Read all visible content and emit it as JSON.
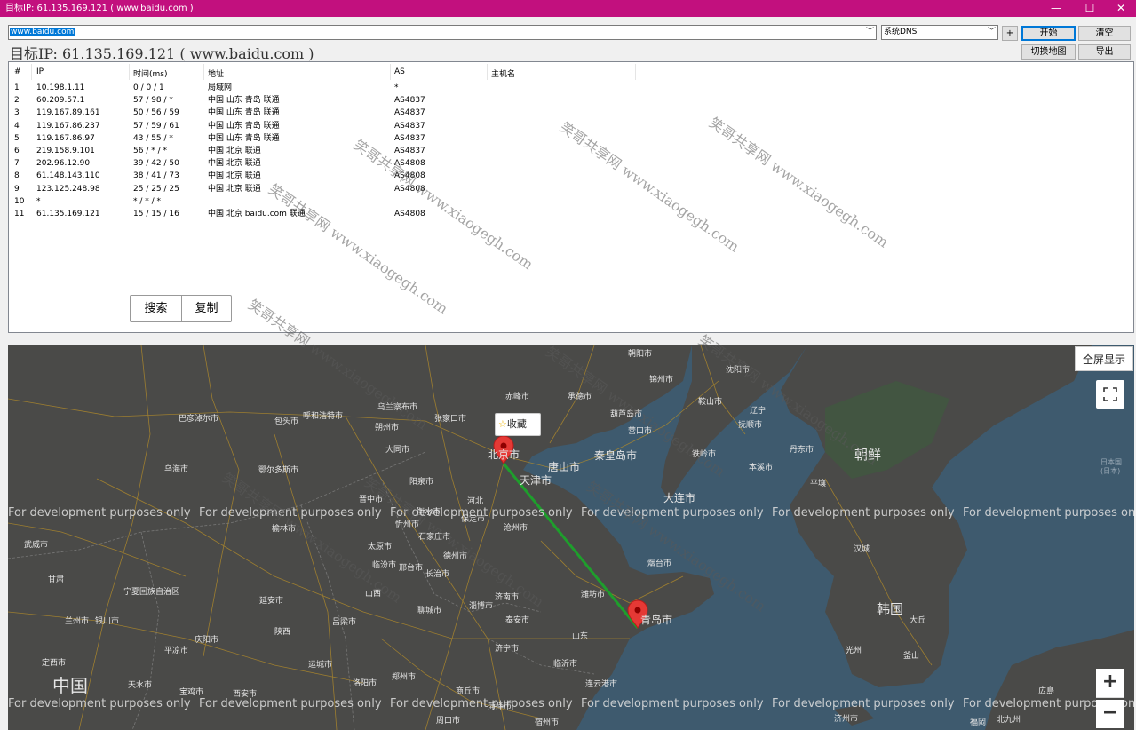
{
  "window": {
    "title": "目标IP: 61.135.169.121 ( www.baidu.com )",
    "minimize": "—",
    "maximize": "☐",
    "close": "✕"
  },
  "toolbar": {
    "url_value": "www.baidu.com",
    "dns_value": "系统DNS",
    "plus_label": "+",
    "start_label": "开始",
    "clear_label": "清空",
    "switch_map_label": "切换地图",
    "export_label": "导出"
  },
  "target_line": "目标IP: 61.135.169.121 ( www.baidu.com )",
  "table": {
    "columns": [
      "#",
      "IP",
      "时间(ms)",
      "地址",
      "AS",
      "主机名"
    ],
    "rows": [
      {
        "num": "1",
        "ip": "10.198.1.11",
        "time": "0 / 0 / 1",
        "addr": "局域网",
        "as": "*",
        "host": ""
      },
      {
        "num": "2",
        "ip": "60.209.57.1",
        "time": "57 / 98 / *",
        "addr": "中国 山东 青岛 联通",
        "as": "AS4837",
        "host": ""
      },
      {
        "num": "3",
        "ip": "119.167.89.161",
        "time": "50 / 56 / 59",
        "addr": "中国 山东 青岛 联通",
        "as": "AS4837",
        "host": ""
      },
      {
        "num": "4",
        "ip": "119.167.86.237",
        "time": "57 / 59 / 61",
        "addr": "中国 山东 青岛 联通",
        "as": "AS4837",
        "host": ""
      },
      {
        "num": "5",
        "ip": "119.167.86.97",
        "time": "43 / 55 / *",
        "addr": "中国 山东 青岛 联通",
        "as": "AS4837",
        "host": ""
      },
      {
        "num": "6",
        "ip": "219.158.9.101",
        "time": "56 / * / *",
        "addr": "中国 北京 联通",
        "as": "AS4837",
        "host": ""
      },
      {
        "num": "7",
        "ip": "202.96.12.90",
        "time": "39 / 42 / 50",
        "addr": "中国 北京 联通",
        "as": "AS4808",
        "host": ""
      },
      {
        "num": "8",
        "ip": "61.148.143.110",
        "time": "38 / 41 / 73",
        "addr": "中国 北京 联通",
        "as": "AS4808",
        "host": ""
      },
      {
        "num": "9",
        "ip": "123.125.248.98",
        "time": "25 / 25 / 25",
        "addr": "中国 北京 联通",
        "as": "AS4808",
        "host": ""
      },
      {
        "num": "10",
        "ip": "*",
        "time": "* / * / *",
        "addr": "",
        "as": "",
        "host": ""
      },
      {
        "num": "11",
        "ip": "61.135.169.121",
        "time": "15 / 15 / 16",
        "addr": "中国 北京 baidu.com 联通",
        "as": "AS4808",
        "host": ""
      }
    ]
  },
  "actions": {
    "search_label": "搜索",
    "copy_label": "复制"
  },
  "map": {
    "fullscreen_label": "全屏显示",
    "favorite_label": "收藏",
    "zoom_in": "+",
    "zoom_out": "−",
    "dev_notice": "For development purposes only",
    "country_china": "中国",
    "korea": "韩国",
    "north_korea": "朝鲜",
    "japan": "日本国\n(日本)",
    "city_labels": [
      "北京市",
      "天津市",
      "唐山市",
      "秦皇岛市",
      "大连市",
      "青岛市",
      "沈阳市",
      "锦州市",
      "营口市",
      "鞍山市",
      "辽宁",
      "石家庄市",
      "保定市",
      "沧州市",
      "邢台市",
      "济南市",
      "淄博市",
      "潍坊市",
      "烟台市",
      "济宁市",
      "临沂市",
      "连云港市",
      "郑州市",
      "太原市",
      "呼和浩特市",
      "包头市",
      "大同市",
      "张家口市",
      "乌兰察布市",
      "巴彦淖尔市",
      "乌海市",
      "鄂尔多斯市",
      "银川市",
      "兰州市",
      "西安市",
      "延安市",
      "吕梁市",
      "榆林市",
      "忻州市",
      "运城市",
      "洛阳市",
      "平壤",
      "汉城",
      "光州",
      "大丘",
      "釜山",
      "広島",
      "福岡",
      "北九州",
      "济州市",
      "朝阳市",
      "葫芦岛市",
      "宁夏回族自治区",
      "甘肃",
      "河北",
      "山东",
      "陕西",
      "山西",
      "武威市",
      "天水市",
      "宝鸡市",
      "平凉市",
      "庆阳市",
      "定西市",
      "商丘市",
      "菏泽市",
      "宿州市",
      "周口市",
      "聊城市",
      "泰安市",
      "德州市",
      "衡水市",
      "晋中市",
      "临汾市",
      "长治市",
      "阳泉市",
      "朔州市",
      "赤峰市",
      "承德市",
      "铁岭市",
      "抚顺市",
      "本溪市",
      "丹东市"
    ],
    "watermark": "笑哥共享网 www.xiaogegh.com"
  },
  "colors": {
    "titlebar": "#c2107e",
    "route": "#1e9e2c",
    "marker": "#e53935"
  }
}
